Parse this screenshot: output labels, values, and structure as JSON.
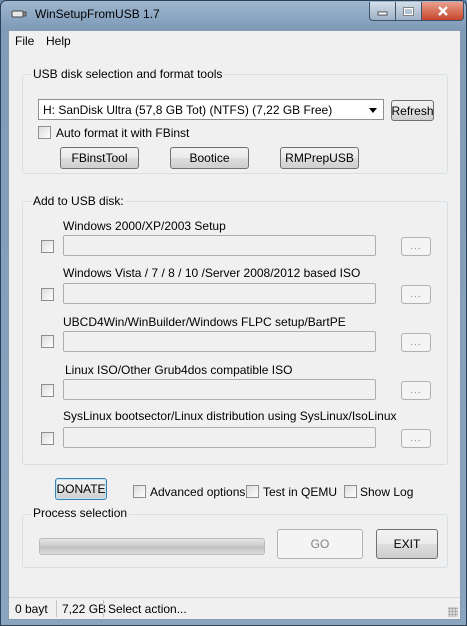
{
  "window": {
    "title": "WinSetupFromUSB 1.7"
  },
  "menu": {
    "file": "File",
    "help": "Help"
  },
  "usb_group": {
    "label": "USB disk selection and format tools",
    "disk_selected": "H: SanDisk Ultra (57,8 GB Tot) (NTFS) (7,22 GB Free)",
    "refresh_label": "Refresh",
    "auto_format_label": "Auto format it with FBinst",
    "fbinsttool_label": "FBinstTool",
    "bootice_label": "Bootice",
    "rmprepusb_label": "RMPrepUSB"
  },
  "add_group": {
    "label": "Add to USB disk:",
    "browse_label": "...",
    "items": [
      {
        "label": "Windows 2000/XP/2003 Setup",
        "value": ""
      },
      {
        "label": "Windows Vista / 7 / 8 / 10 /Server 2008/2012 based ISO",
        "value": ""
      },
      {
        "label": "UBCD4Win/WinBuilder/Windows FLPC setup/BartPE",
        "value": ""
      },
      {
        "label": "Linux ISO/Other Grub4dos compatible ISO",
        "value": ""
      },
      {
        "label": "SysLinux bootsector/Linux distribution using SysLinux/IsoLinux",
        "value": ""
      }
    ]
  },
  "options": {
    "donate_label": "DONATE",
    "advanced_label": "Advanced options",
    "qemu_label": "Test in QEMU",
    "showlog_label": "Show Log"
  },
  "process": {
    "label": "Process selection",
    "progress": 0,
    "go_label": "GO",
    "exit_label": "EXIT"
  },
  "status": {
    "bytes": "0 bayt",
    "free": "7,22 GB",
    "message": "Select action..."
  }
}
